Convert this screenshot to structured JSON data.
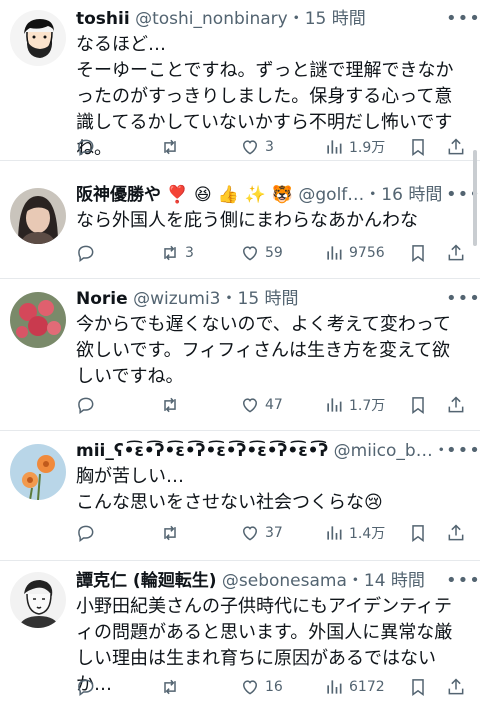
{
  "replies": [
    {
      "name": "toshii",
      "handle": "@toshi_nonbinary",
      "time": "・15 時間",
      "text": "なるほど…\nそーゆーことですね。ずっと謎で理解できなかったのがすっきりしました。保身する心って意識してるかしていないかすら不明だし怖いですね。",
      "replies": "",
      "retweets": "",
      "likes": "3",
      "views": "1.9万",
      "avatar_icon": "cartoon-man-avatar"
    },
    {
      "name": "阪神優勝や ❣️ 😆 👍 ✨ 🐯",
      "handle": "@golf…",
      "time": "・16 時間",
      "text": "なら外国人を庇う側にまわらなあかんわな",
      "replies": "",
      "retweets": "3",
      "likes": "59",
      "views": "9756",
      "avatar_icon": "woman-photo-avatar"
    },
    {
      "name": "Norie",
      "handle": "@wizumi3",
      "time": "・15 時間",
      "text": "今からでも遅くないので、よく考えて変わって欲しいです。フィフィさんは生き方を変えて欲しいですね。",
      "replies": "",
      "retweets": "",
      "likes": "47",
      "views": "1.7万",
      "avatar_icon": "red-flowers-avatar"
    },
    {
      "name": "mii_ʕ•͡ɛ•͡ʔ•͡ɛ•͡ʔ•͡ɛ•͡ʔ•͡ɛ•͡ʔ•͡ɛ•͡ʔ",
      "handle": "@miico_b…",
      "time": "・16 時間",
      "text": "胸が苦しい…\nこんな思いをさせない社会つくらな😢",
      "replies": "",
      "retweets": "",
      "likes": "37",
      "views": "1.4万",
      "avatar_icon": "orange-flower-avatar"
    },
    {
      "name": "譚克仁 (輪廻転生)",
      "handle": "@sebonesama",
      "time": "・14 時間",
      "text": "小野田紀美さんの子供時代にもアイデンティティの問題があると思います。外国人に異常な厳しい理由は生まれ育ちに原因があるではないか…",
      "replies": "",
      "retweets": "",
      "likes": "16",
      "views": "6172",
      "avatar_icon": "sketch-man-avatar"
    }
  ],
  "icons": {
    "more": "more-dots-icon",
    "reply": "reply-bubble-icon",
    "retweet": "retweet-icon",
    "like": "heart-icon",
    "views": "views-bar-icon",
    "bookmark": "bookmark-icon",
    "share": "share-icon"
  },
  "colors": {
    "text": "#0f1419",
    "secondary": "#536471",
    "divider": "#e6e9ec"
  }
}
